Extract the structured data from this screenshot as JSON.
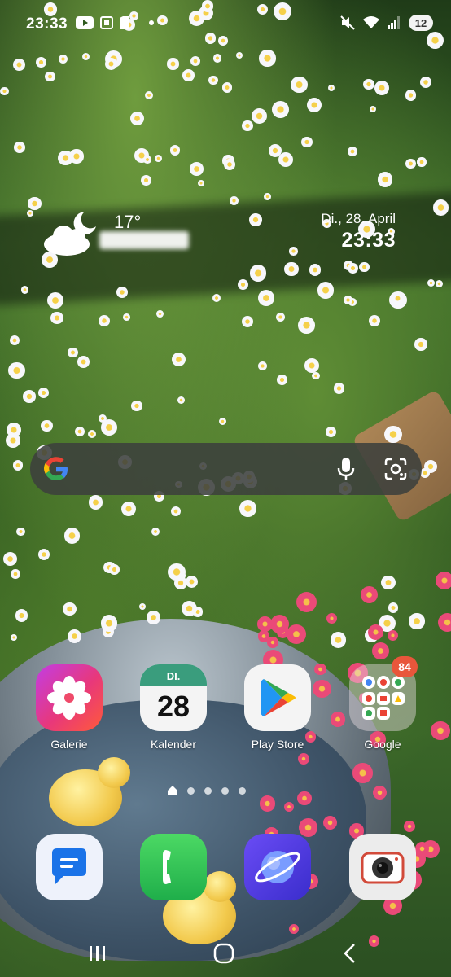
{
  "status_bar": {
    "time": "23:33",
    "battery": "12",
    "icons": [
      "youtube-icon",
      "screenshot-icon",
      "sim-icon",
      "dot-icon",
      "mute-icon",
      "wifi-icon",
      "signal-icon"
    ]
  },
  "weather": {
    "temperature": "17°",
    "icon": "partly-cloudy-night-icon"
  },
  "clock_widget": {
    "date": "Di., 28. April",
    "time": "23:33"
  },
  "search_bar": {
    "icons": [
      "google-logo",
      "mic-icon",
      "lens-icon"
    ]
  },
  "apps": [
    {
      "label": "Galerie",
      "icon": "gallery-icon"
    },
    {
      "label": "Kalender",
      "icon": "calendar-icon",
      "weekday": "DI.",
      "day": "28"
    },
    {
      "label": "Play Store",
      "icon": "play-store-icon"
    },
    {
      "label": "Google",
      "icon": "folder-icon",
      "badge": "84"
    }
  ],
  "dock": [
    {
      "icon": "messages-icon"
    },
    {
      "icon": "phone-icon"
    },
    {
      "icon": "internet-icon"
    },
    {
      "icon": "camera-icon"
    }
  ],
  "colors": {
    "accent_badge": "#e8563b",
    "search_bg": "#3c403c"
  }
}
